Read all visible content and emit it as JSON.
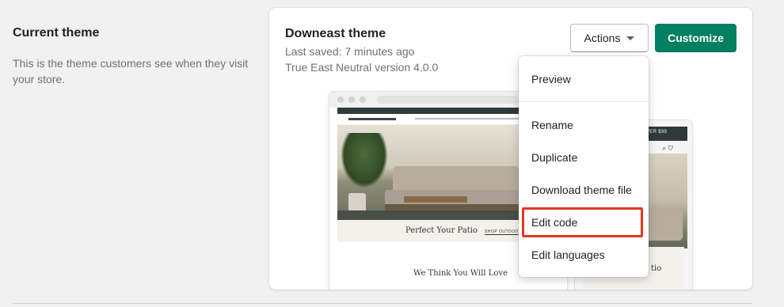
{
  "section": {
    "title": "Current theme",
    "description": "This is the theme customers see when they visit your store."
  },
  "theme": {
    "name": "Downeast theme",
    "last_saved": "Last saved: 7 minutes ago",
    "version": "True East Neutral version 4.0.0"
  },
  "buttons": {
    "actions_label": "Actions",
    "customize_label": "Customize"
  },
  "preview": {
    "hero_heading": "Perfect Your Patio",
    "shop_link": "SHOP OUTDOOR",
    "section_heading": "We Think You Will Love",
    "mobile_banner": "VER $99",
    "mobile_card_text": "tio"
  },
  "actions_menu": {
    "items": [
      {
        "label": "Preview"
      },
      {
        "label": "Rename"
      },
      {
        "label": "Duplicate"
      },
      {
        "label": "Download theme file"
      },
      {
        "label": "Edit code"
      },
      {
        "label": "Edit languages"
      }
    ],
    "highlighted": "Edit code",
    "highlight_color": "#e2391e"
  },
  "colors": {
    "primary_button": "#008060",
    "page_background": "#f1f1f1"
  }
}
